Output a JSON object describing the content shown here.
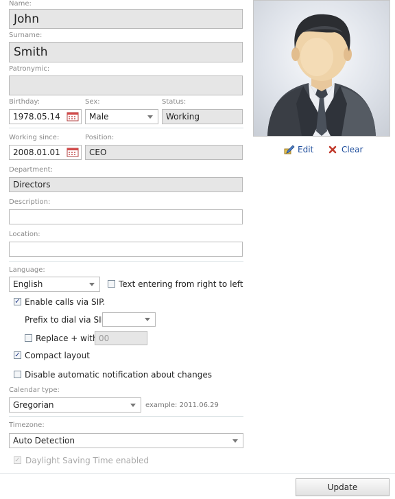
{
  "personal": {
    "name_label": "Name:",
    "name_value": "John",
    "surname_label": "Surname:",
    "surname_value": "Smith",
    "patronymic_label": "Patronymic:",
    "patronymic_value": "",
    "birthday_label": "Birthday:",
    "birthday_value": "1978.05.14",
    "sex_label": "Sex:",
    "sex_value": "Male",
    "status_label": "Status:",
    "status_value": "Working"
  },
  "work": {
    "working_since_label": "Working since:",
    "working_since_value": "2008.01.01",
    "position_label": "Position:",
    "position_value": "CEO",
    "department_label": "Department:",
    "department_value": "Directors",
    "description_label": "Description:",
    "description_value": "",
    "location_label": "Location:",
    "location_value": ""
  },
  "photo": {
    "edit_label": "Edit",
    "clear_label": "Clear"
  },
  "settings": {
    "language_label": "Language:",
    "language_value": "English",
    "rtl_label": "Text entering from right to left",
    "rtl_checked": false,
    "sip_label": "Enable calls via SIP.",
    "sip_checked": true,
    "prefix_label": "Prefix to dial via SIP:",
    "prefix_value": "",
    "replace_label": "Replace + with",
    "replace_value": "00",
    "replace_checked": false,
    "compact_label": "Compact layout",
    "compact_checked": true,
    "disable_notify_label": "Disable automatic notification about changes",
    "disable_notify_checked": false,
    "calendar_label": "Calendar type:",
    "calendar_value": "Gregorian",
    "calendar_example": "example: 2011.06.29",
    "timezone_label": "Timezone:",
    "timezone_value": "Auto Detection",
    "dst_label": "Daylight Saving Time enabled",
    "dst_checked": true
  },
  "actions": {
    "update_label": "Update"
  },
  "icons": {
    "calendar": "calendar-icon",
    "edit": "pencil-icon",
    "clear": "red-x-icon",
    "avatar": "avatar-man-in-suit"
  },
  "colors": {
    "readonly_bg": "#e6e6e6",
    "link": "#1f4e9c",
    "clear_x": "#c0392b",
    "separator": "#d6dfe2"
  }
}
